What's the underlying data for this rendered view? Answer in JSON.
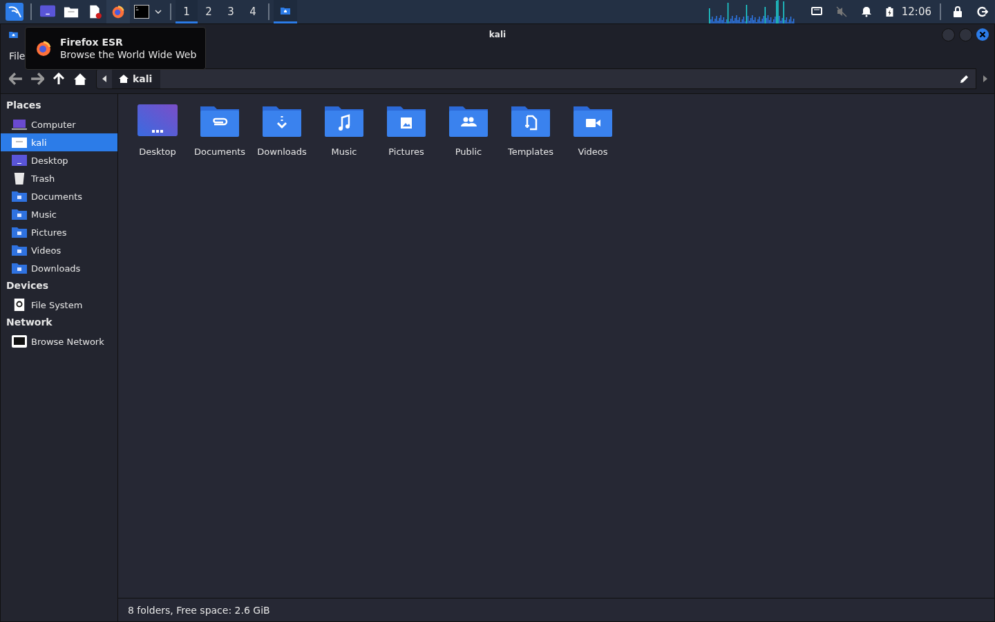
{
  "taskbar": {
    "launchers": [
      {
        "kind": "desktop",
        "selected": false
      },
      {
        "kind": "files",
        "selected": false
      },
      {
        "kind": "editor",
        "selected": false
      },
      {
        "kind": "firefox",
        "selected": true
      },
      {
        "kind": "terminal",
        "selected": false
      }
    ],
    "workspaces": [
      {
        "label": "1",
        "selected": true
      },
      {
        "label": "2",
        "selected": false
      },
      {
        "label": "3",
        "selected": false
      },
      {
        "label": "4",
        "selected": false
      }
    ],
    "clock": "12:06"
  },
  "tooltip": {
    "title": "Firefox ESR",
    "text": "Browse the World Wide Web"
  },
  "window": {
    "title": "kali"
  },
  "menu": [
    "File"
  ],
  "path": {
    "current": "kali"
  },
  "sidebar": [
    {
      "heading": "Places",
      "items": [
        {
          "label": "Computer",
          "kind": "computer",
          "selected": false
        },
        {
          "label": "kali",
          "kind": "home",
          "selected": true
        },
        {
          "label": "Desktop",
          "kind": "desktop",
          "selected": false
        },
        {
          "label": "Trash",
          "kind": "trash",
          "selected": false
        },
        {
          "label": "Documents",
          "kind": "documents",
          "selected": false
        },
        {
          "label": "Music",
          "kind": "music",
          "selected": false
        },
        {
          "label": "Pictures",
          "kind": "pictures",
          "selected": false
        },
        {
          "label": "Videos",
          "kind": "videos",
          "selected": false
        },
        {
          "label": "Downloads",
          "kind": "downloads",
          "selected": false
        }
      ]
    },
    {
      "heading": "Devices",
      "items": [
        {
          "label": "File System",
          "kind": "drive",
          "selected": false
        }
      ]
    },
    {
      "heading": "Network",
      "items": [
        {
          "label": "Browse Network",
          "kind": "network",
          "selected": false
        }
      ]
    }
  ],
  "folders": [
    {
      "label": "Desktop",
      "kind": "desktop"
    },
    {
      "label": "Documents",
      "kind": "documents"
    },
    {
      "label": "Downloads",
      "kind": "downloads"
    },
    {
      "label": "Music",
      "kind": "music"
    },
    {
      "label": "Pictures",
      "kind": "pictures"
    },
    {
      "label": "Public",
      "kind": "public"
    },
    {
      "label": "Templates",
      "kind": "templates"
    },
    {
      "label": "Videos",
      "kind": "videos"
    }
  ],
  "status_bar": "8 folders, Free space: 2.6 GiB"
}
